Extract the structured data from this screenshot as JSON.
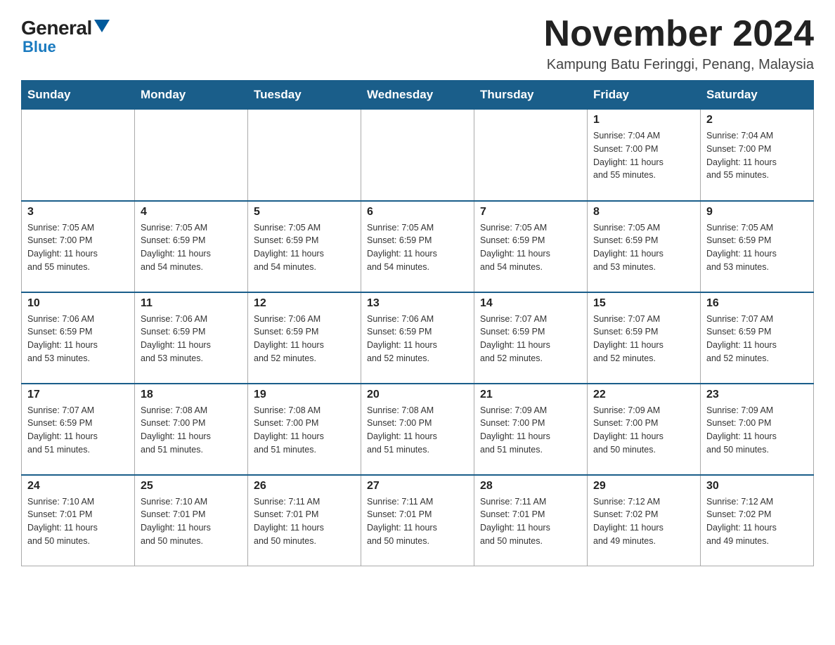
{
  "logo": {
    "general": "General",
    "blue": "Blue"
  },
  "header": {
    "month_year": "November 2024",
    "location": "Kampung Batu Feringgi, Penang, Malaysia"
  },
  "days_of_week": [
    "Sunday",
    "Monday",
    "Tuesday",
    "Wednesday",
    "Thursday",
    "Friday",
    "Saturday"
  ],
  "weeks": [
    [
      {
        "num": "",
        "info": ""
      },
      {
        "num": "",
        "info": ""
      },
      {
        "num": "",
        "info": ""
      },
      {
        "num": "",
        "info": ""
      },
      {
        "num": "",
        "info": ""
      },
      {
        "num": "1",
        "info": "Sunrise: 7:04 AM\nSunset: 7:00 PM\nDaylight: 11 hours\nand 55 minutes."
      },
      {
        "num": "2",
        "info": "Sunrise: 7:04 AM\nSunset: 7:00 PM\nDaylight: 11 hours\nand 55 minutes."
      }
    ],
    [
      {
        "num": "3",
        "info": "Sunrise: 7:05 AM\nSunset: 7:00 PM\nDaylight: 11 hours\nand 55 minutes."
      },
      {
        "num": "4",
        "info": "Sunrise: 7:05 AM\nSunset: 6:59 PM\nDaylight: 11 hours\nand 54 minutes."
      },
      {
        "num": "5",
        "info": "Sunrise: 7:05 AM\nSunset: 6:59 PM\nDaylight: 11 hours\nand 54 minutes."
      },
      {
        "num": "6",
        "info": "Sunrise: 7:05 AM\nSunset: 6:59 PM\nDaylight: 11 hours\nand 54 minutes."
      },
      {
        "num": "7",
        "info": "Sunrise: 7:05 AM\nSunset: 6:59 PM\nDaylight: 11 hours\nand 54 minutes."
      },
      {
        "num": "8",
        "info": "Sunrise: 7:05 AM\nSunset: 6:59 PM\nDaylight: 11 hours\nand 53 minutes."
      },
      {
        "num": "9",
        "info": "Sunrise: 7:05 AM\nSunset: 6:59 PM\nDaylight: 11 hours\nand 53 minutes."
      }
    ],
    [
      {
        "num": "10",
        "info": "Sunrise: 7:06 AM\nSunset: 6:59 PM\nDaylight: 11 hours\nand 53 minutes."
      },
      {
        "num": "11",
        "info": "Sunrise: 7:06 AM\nSunset: 6:59 PM\nDaylight: 11 hours\nand 53 minutes."
      },
      {
        "num": "12",
        "info": "Sunrise: 7:06 AM\nSunset: 6:59 PM\nDaylight: 11 hours\nand 52 minutes."
      },
      {
        "num": "13",
        "info": "Sunrise: 7:06 AM\nSunset: 6:59 PM\nDaylight: 11 hours\nand 52 minutes."
      },
      {
        "num": "14",
        "info": "Sunrise: 7:07 AM\nSunset: 6:59 PM\nDaylight: 11 hours\nand 52 minutes."
      },
      {
        "num": "15",
        "info": "Sunrise: 7:07 AM\nSunset: 6:59 PM\nDaylight: 11 hours\nand 52 minutes."
      },
      {
        "num": "16",
        "info": "Sunrise: 7:07 AM\nSunset: 6:59 PM\nDaylight: 11 hours\nand 52 minutes."
      }
    ],
    [
      {
        "num": "17",
        "info": "Sunrise: 7:07 AM\nSunset: 6:59 PM\nDaylight: 11 hours\nand 51 minutes."
      },
      {
        "num": "18",
        "info": "Sunrise: 7:08 AM\nSunset: 7:00 PM\nDaylight: 11 hours\nand 51 minutes."
      },
      {
        "num": "19",
        "info": "Sunrise: 7:08 AM\nSunset: 7:00 PM\nDaylight: 11 hours\nand 51 minutes."
      },
      {
        "num": "20",
        "info": "Sunrise: 7:08 AM\nSunset: 7:00 PM\nDaylight: 11 hours\nand 51 minutes."
      },
      {
        "num": "21",
        "info": "Sunrise: 7:09 AM\nSunset: 7:00 PM\nDaylight: 11 hours\nand 51 minutes."
      },
      {
        "num": "22",
        "info": "Sunrise: 7:09 AM\nSunset: 7:00 PM\nDaylight: 11 hours\nand 50 minutes."
      },
      {
        "num": "23",
        "info": "Sunrise: 7:09 AM\nSunset: 7:00 PM\nDaylight: 11 hours\nand 50 minutes."
      }
    ],
    [
      {
        "num": "24",
        "info": "Sunrise: 7:10 AM\nSunset: 7:01 PM\nDaylight: 11 hours\nand 50 minutes."
      },
      {
        "num": "25",
        "info": "Sunrise: 7:10 AM\nSunset: 7:01 PM\nDaylight: 11 hours\nand 50 minutes."
      },
      {
        "num": "26",
        "info": "Sunrise: 7:11 AM\nSunset: 7:01 PM\nDaylight: 11 hours\nand 50 minutes."
      },
      {
        "num": "27",
        "info": "Sunrise: 7:11 AM\nSunset: 7:01 PM\nDaylight: 11 hours\nand 50 minutes."
      },
      {
        "num": "28",
        "info": "Sunrise: 7:11 AM\nSunset: 7:01 PM\nDaylight: 11 hours\nand 50 minutes."
      },
      {
        "num": "29",
        "info": "Sunrise: 7:12 AM\nSunset: 7:02 PM\nDaylight: 11 hours\nand 49 minutes."
      },
      {
        "num": "30",
        "info": "Sunrise: 7:12 AM\nSunset: 7:02 PM\nDaylight: 11 hours\nand 49 minutes."
      }
    ]
  ]
}
